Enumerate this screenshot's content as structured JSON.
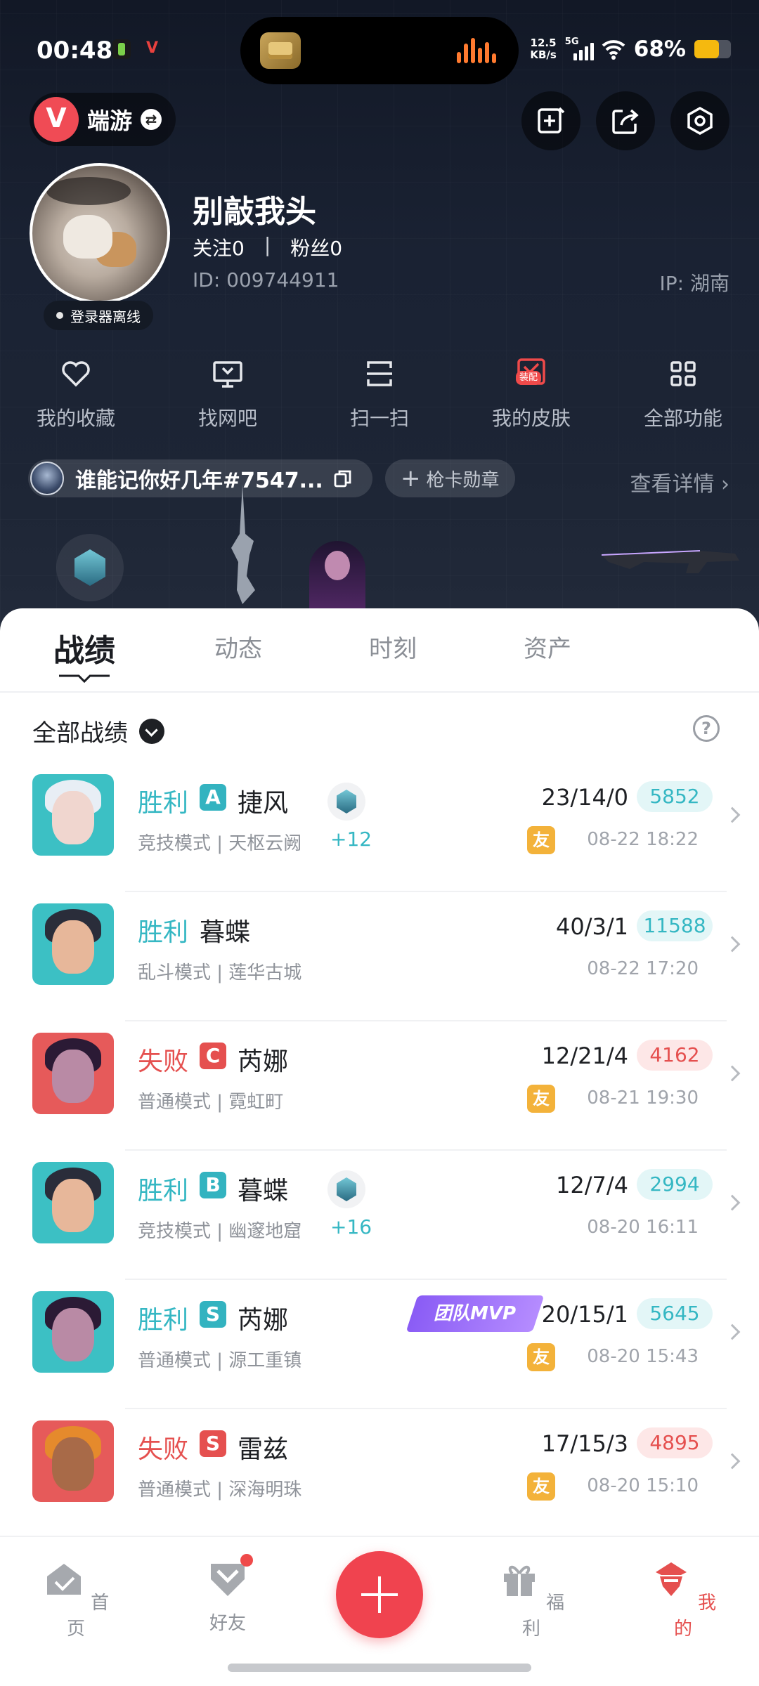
{
  "status_bar": {
    "time": "00:48",
    "speed_value": "12.5",
    "speed_unit": "KB/s",
    "network": "5G",
    "battery_percent": "68%",
    "battery_level": 0.68,
    "battery_color": "#f5b90f"
  },
  "header": {
    "game_name": "端游"
  },
  "profile": {
    "nickname": "别敲我头",
    "follow_label": "关注0",
    "fans_label": "粉丝0",
    "separator": "|",
    "id_label": "ID:  009744911",
    "ip_label": "IP:  湖南",
    "login_status": "登录器离线"
  },
  "features": [
    {
      "label": "我的收藏",
      "icon": "heart-icon"
    },
    {
      "label": "找网吧",
      "icon": "monitor-icon"
    },
    {
      "label": "扫一扫",
      "icon": "scan-icon"
    },
    {
      "label": "我的皮肤",
      "icon": "skin-icon",
      "badge": "装配"
    },
    {
      "label": "全部功能",
      "icon": "grid-icon"
    }
  ],
  "card": {
    "name": "谁能记你好几年#7547...",
    "medal_label": "枪卡勋章",
    "details_label": "查看详情"
  },
  "tabs": [
    "战绩",
    "动态",
    "时刻",
    "资产"
  ],
  "filter_label": "全部战绩",
  "matches": [
    {
      "result": "胜利",
      "outcome": "win",
      "grade": "A",
      "agent": "捷风",
      "mode": "竞技模式 | 天枢云阙",
      "rank_delta": "+12",
      "has_rank": true,
      "mvp": "",
      "kda": "23/14/0",
      "score": "5852",
      "friend": true,
      "time": "08-22 18:22",
      "thumb_bg": "#3cc0c4",
      "face": "#f0d6cf",
      "hair": "#e8eef5"
    },
    {
      "result": "胜利",
      "outcome": "win",
      "grade": "",
      "agent": "暮蝶",
      "mode": "乱斗模式 | 莲华古城",
      "rank_delta": "",
      "has_rank": false,
      "mvp": "",
      "kda": "40/3/1",
      "score": "11588",
      "friend": false,
      "time": "08-22 17:20",
      "thumb_bg": "#3cc0c4",
      "face": "#e7b79a",
      "hair": "#2a2d3a"
    },
    {
      "result": "失败",
      "outcome": "lose",
      "grade": "C",
      "agent": "芮娜",
      "mode": "普通模式 | 霓虹町",
      "rank_delta": "",
      "has_rank": false,
      "mvp": "",
      "kda": "12/21/4",
      "score": "4162",
      "friend": true,
      "time": "08-21 19:30",
      "thumb_bg": "#e65a5a",
      "face": "#b98aa5",
      "hair": "#2b1a35"
    },
    {
      "result": "胜利",
      "outcome": "win",
      "grade": "B",
      "agent": "暮蝶",
      "mode": "竞技模式 | 幽邃地窟",
      "rank_delta": "+16",
      "has_rank": true,
      "mvp": "",
      "kda": "12/7/4",
      "score": "2994",
      "friend": false,
      "time": "08-20 16:11",
      "thumb_bg": "#3cc0c4",
      "face": "#e7b79a",
      "hair": "#2a2d3a"
    },
    {
      "result": "胜利",
      "outcome": "win",
      "grade": "S",
      "agent": "芮娜",
      "mode": "普通模式 | 源工重镇",
      "rank_delta": "",
      "has_rank": false,
      "mvp": "团队MVP",
      "kda": "20/15/1",
      "score": "5645",
      "friend": true,
      "time": "08-20 15:43",
      "thumb_bg": "#3cc0c4",
      "face": "#b98aa5",
      "hair": "#2b1a35"
    },
    {
      "result": "失败",
      "outcome": "lose",
      "grade": "S",
      "agent": "雷兹",
      "mode": "普通模式 | 深海明珠",
      "rank_delta": "",
      "has_rank": false,
      "mvp": "",
      "kda": "17/15/3",
      "score": "4895",
      "friend": true,
      "time": "08-20 15:10",
      "thumb_bg": "#e65a5a",
      "face": "#a86a48",
      "hair": "#e58a2c"
    }
  ],
  "friend_tag": "友",
  "bottom_nav": [
    {
      "label": "首页",
      "icon": "home-icon",
      "active": false
    },
    {
      "label": "好友",
      "icon": "friends-icon",
      "active": false,
      "dot": true
    },
    {
      "label": "福利",
      "icon": "gift-icon",
      "active": false
    },
    {
      "label": "我的",
      "icon": "profile-icon",
      "active": true
    }
  ],
  "colors": {
    "accent": "#f0434f",
    "win": "#35b7c3",
    "lose": "#e5504f"
  }
}
